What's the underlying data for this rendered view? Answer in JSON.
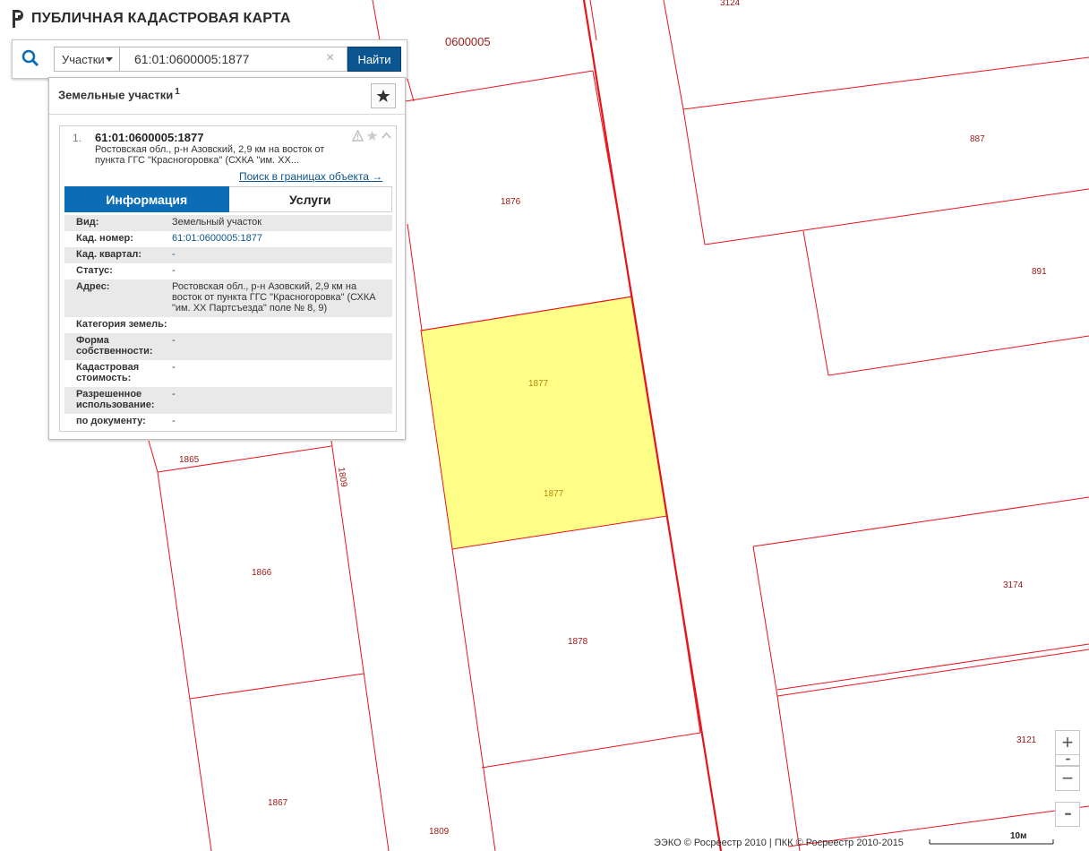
{
  "app": {
    "title": "ПУБЛИЧНАЯ КАДАСТРОВАЯ КАРТА"
  },
  "search": {
    "type_label": "Участки",
    "query": "61:01:0600005:1877",
    "find_label": "Найти"
  },
  "results": {
    "title": "Земельные участки",
    "count": "1",
    "item": {
      "number": "1.",
      "cad_id": "61:01:0600005:1877",
      "address_short": "Ростовская обл., р-н Азовский, 2,9 км на восток от пункта ГГС \"Красногоровка\" (СХКА \"им. XX...",
      "search_within_label": "Поиск в границах объекта →"
    },
    "tabs": {
      "info": "Информация",
      "services": "Услуги"
    },
    "info": [
      {
        "label": "Вид:",
        "value": "Земельный участок"
      },
      {
        "label": "Кад. номер:",
        "value": "61:01:0600005:1877"
      },
      {
        "label": "Кад. квартал:",
        "value": "-"
      },
      {
        "label": "Статус:",
        "value": "-"
      },
      {
        "label": "Адрес:",
        "value": "Ростовская обл., р-н Азовский, 2,9 км на восток от пункта ГГС \"Красногоровка\" (СХКА \"им. XX Партсъезда\" поле № 8, 9)"
      },
      {
        "label": "Категория земель:",
        "value": ""
      },
      {
        "label": "Форма собственности:",
        "value": "-"
      },
      {
        "label": "Кадастровая стоимость:",
        "value": "-"
      },
      {
        "label": "Разрешенное использование:",
        "value": "-"
      },
      {
        "label": "по документу:",
        "value": "-"
      }
    ]
  },
  "map": {
    "quarter_label": "0600005",
    "parcel_labels": {
      "p3124": "3124",
      "p887": "887",
      "p1876": "1876",
      "p891": "891",
      "p1877a": "1877",
      "p1877b": "1877",
      "p1865": "1865",
      "p1809a": "1809",
      "p1866": "1866",
      "p1878": "1878",
      "p3174": "3174",
      "p3121": "3121",
      "p1867": "1867",
      "p1809b": "1809"
    },
    "colors": {
      "boundary": "#e8141c",
      "selected_fill": "#ffff88",
      "label": "#a01a1a"
    }
  },
  "controls": {
    "zoom_in": "+",
    "zoom_out": "−",
    "more": "•••"
  },
  "footer": {
    "attribution": "ЭЭКО © Росреестр 2010 | ПКК © Росреестр 2010-2015",
    "scale": "10м"
  }
}
